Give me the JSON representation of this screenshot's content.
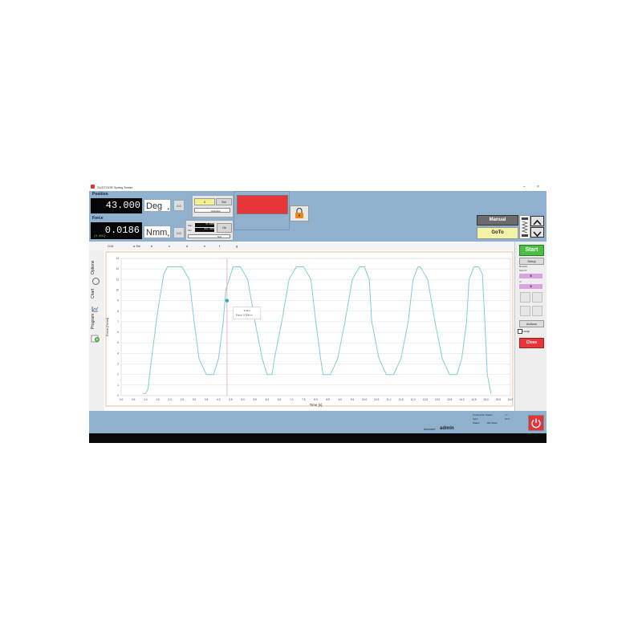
{
  "window": {
    "title": "SUSTOOR Spring Tester",
    "min_glyph": "–",
    "close_glyph": "×"
  },
  "position": {
    "label": "Position",
    "value": "43.000",
    "unit": "Deg",
    "zero_label": "0.0",
    "set_value": "0",
    "set_label": "Set",
    "mode_select": "Absolute",
    "dropdown_glyph": "▾"
  },
  "force": {
    "label": "Force",
    "value": "0.0186",
    "unit": "Nmm",
    "sub_value": "[0.000]",
    "zero_label": "0.0",
    "mini_values": [
      "0.000",
      "13.300"
    ],
    "mini_label_a": "Max",
    "mini_label_b": "Min",
    "ok_label": "Ok",
    "select_value": "N/A"
  },
  "controls": {
    "manual_label": "Manual",
    "goto_label": "GoTo",
    "up_glyph": "▲",
    "down_glyph": "▼"
  },
  "tabs": {
    "first": "D16",
    "second": "a Sin",
    "letters": [
      "b",
      "c",
      "d",
      "e",
      "f",
      "g"
    ]
  },
  "side_tabs": {
    "options": "Options",
    "chart": "Chart",
    "program": "Program"
  },
  "right_panel": {
    "start": "Start",
    "setup": "Setup",
    "results_label": "Results",
    "test_label": "Test N°",
    "test_value": "5",
    "of_label": "of",
    "of_value": "5",
    "actions": "Actions",
    "loop": "Loop",
    "close": "Close"
  },
  "status": {
    "connection_label": "Connection Status",
    "connection_value": "OK",
    "sync_label": "Sync",
    "sync_value": "10.0",
    "status_label": "Status",
    "status_value": "idle State",
    "account_label": "Account",
    "account_value": "admin"
  },
  "colors": {
    "accent": "#8fb1cd",
    "series": "#7fcfd3",
    "start": "#4cbf43",
    "close": "#e8353a",
    "magenta": "#d9a3df"
  },
  "chart_data": {
    "type": "line",
    "xlabel": "Time [s]",
    "ylabel": "Force [Nmm]",
    "xlim": [
      0,
      16
    ],
    "ylim": [
      0,
      13
    ],
    "xticks": [
      "0.0",
      "0.5",
      "1.0",
      "1.5",
      "2.0",
      "2.5",
      "3.0",
      "3.5",
      "4.0",
      "4.5",
      "5.0",
      "5.5",
      "6.0",
      "6.5",
      "7.0",
      "7.5",
      "8.0",
      "8.5",
      "9.0",
      "9.5",
      "10.0",
      "10.5",
      "11.0",
      "11.5",
      "12.0",
      "12.5",
      "13.0",
      "13.5",
      "14.0",
      "14.5",
      "15.0",
      "15.5",
      "16.0"
    ],
    "yticks": [
      "0",
      "1",
      "2",
      "3",
      "4",
      "5",
      "6",
      "7",
      "8",
      "9",
      "10",
      "11",
      "12",
      "13"
    ],
    "cursor": {
      "x": 4.35,
      "y": 9.0
    },
    "tooltip": [
      "9.40 s",
      "Force: 9.0Nmm"
    ],
    "series": [
      {
        "x": [
          0.9,
          1.0,
          1.1,
          1.25,
          1.5,
          1.75,
          1.9,
          2.0,
          2.3,
          2.5,
          2.8,
          3.0,
          3.2,
          3.5,
          3.8,
          4.0,
          4.2,
          4.3,
          4.6,
          4.9,
          5.2,
          5.5,
          5.8,
          6.0,
          6.2,
          6.3,
          6.6,
          6.9,
          7.2,
          7.5,
          7.8,
          8.0,
          8.2,
          8.3,
          8.6,
          8.9,
          9.2,
          9.5,
          9.8,
          10.0,
          10.2,
          10.3,
          10.6,
          10.9,
          11.2,
          11.5,
          11.8,
          12.0,
          12.2,
          12.3,
          12.6,
          12.9,
          13.2,
          13.5,
          13.8,
          14.0,
          14.2,
          14.3,
          14.5,
          14.7,
          14.85,
          14.95,
          15.05,
          15.2
        ],
        "y": [
          0.2,
          0.2,
          0.6,
          3.5,
          8.0,
          11.5,
          12.2,
          12.2,
          12.2,
          12.2,
          11.0,
          7.0,
          3.5,
          2.0,
          2.0,
          3.5,
          7.0,
          10.0,
          12.2,
          12.2,
          11.0,
          7.0,
          3.5,
          2.0,
          2.0,
          3.5,
          7.0,
          11.0,
          12.2,
          12.2,
          11.0,
          7.0,
          3.5,
          2.0,
          2.0,
          3.5,
          7.0,
          11.0,
          12.2,
          12.2,
          11.0,
          7.0,
          3.5,
          2.0,
          2.0,
          3.5,
          7.0,
          11.0,
          12.2,
          12.2,
          11.0,
          7.0,
          3.5,
          2.0,
          2.0,
          3.5,
          7.0,
          11.0,
          12.2,
          12.2,
          11.5,
          7.0,
          2.0,
          0.2
        ]
      }
    ]
  }
}
